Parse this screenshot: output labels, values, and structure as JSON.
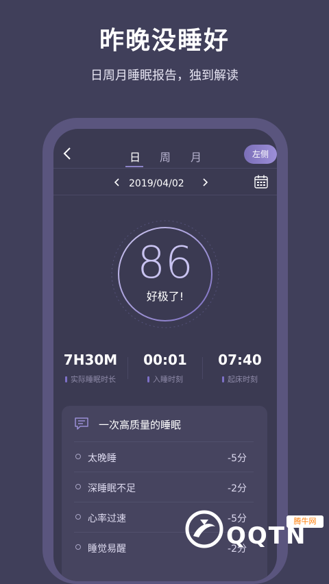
{
  "promo": {
    "headline": "昨晚没睡好",
    "subline": "日周月睡眠报告，独到解读"
  },
  "app": {
    "tabs": [
      {
        "label": "日",
        "active": true
      },
      {
        "label": "周",
        "active": false
      },
      {
        "label": "月",
        "active": false
      }
    ],
    "side_button_label": "左侧",
    "date": "2019/04/02",
    "score": {
      "value": "86",
      "label": "好极了!"
    },
    "stats": [
      {
        "value": "7H30M",
        "label": "实际睡眠时长"
      },
      {
        "value": "00:01",
        "label": "入睡时刻"
      },
      {
        "value": "07:40",
        "label": "起床时刻"
      }
    ],
    "report": {
      "title": "一次高质量的睡眠",
      "items": [
        {
          "name": "太晚睡",
          "points": "-5分"
        },
        {
          "name": "深睡眠不足",
          "points": "-2分"
        },
        {
          "name": "心率过速",
          "points": "-5分"
        },
        {
          "name": "睡觉易醒",
          "points": "-2分"
        }
      ]
    }
  },
  "watermark": {
    "brand": "QQTN",
    "badge": "腾牛网"
  },
  "colors": {
    "background": "#403f5a",
    "screen": "#3b3a52",
    "accent": "#8c83c8",
    "card": "#46445f"
  },
  "icons": [
    "back-arrow-icon",
    "chevron-left-icon",
    "chevron-right-icon",
    "calendar-icon",
    "message-icon",
    "bullet-icon"
  ]
}
